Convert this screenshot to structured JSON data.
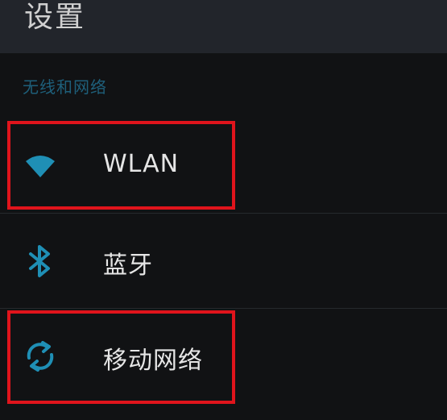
{
  "header": {
    "title": "设置"
  },
  "section": {
    "label": "无线和网络"
  },
  "items": [
    {
      "label": "WLAN",
      "icon": "wifi-icon",
      "highlighted": true
    },
    {
      "label": "蓝牙",
      "icon": "bluetooth-icon",
      "highlighted": false
    },
    {
      "label": "移动网络",
      "icon": "mobile-data-sync-icon",
      "highlighted": true
    }
  ],
  "colors": {
    "accent": "#1f8fb5",
    "highlight_box": "#e0141c",
    "title_bar": "#22252b",
    "background": "#111214"
  }
}
